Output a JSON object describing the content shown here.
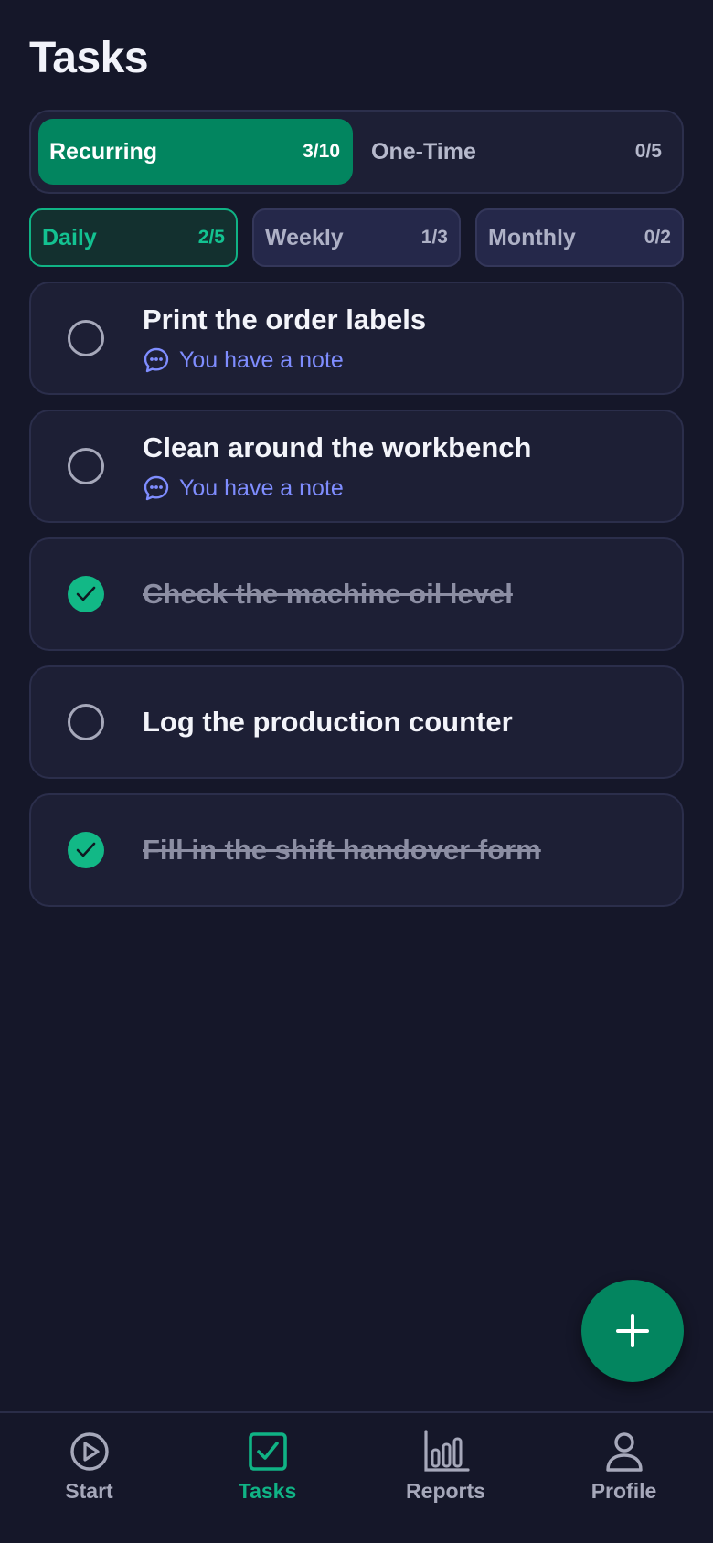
{
  "header": {
    "title": "Tasks"
  },
  "segments": [
    {
      "label": "Recurring",
      "count": "3/10",
      "active": true
    },
    {
      "label": "One-Time",
      "count": "0/5",
      "active": false
    }
  ],
  "frequency": [
    {
      "label": "Daily",
      "count": "2/5",
      "active": true
    },
    {
      "label": "Weekly",
      "count": "1/3",
      "active": false
    },
    {
      "label": "Monthly",
      "count": "0/2",
      "active": false
    }
  ],
  "tasks": [
    {
      "title": "Print the order labels",
      "done": false,
      "note": "You have a note"
    },
    {
      "title": "Clean around the workbench",
      "done": false,
      "note": "You have a note"
    },
    {
      "title": "Check the machine oil level",
      "done": true
    },
    {
      "title": "Log the production counter",
      "done": false
    },
    {
      "title": "Fill in the shift handover form",
      "done": true
    }
  ],
  "nav": [
    {
      "label": "Start",
      "icon": "play-circle-icon",
      "active": false
    },
    {
      "label": "Tasks",
      "icon": "checkbox-icon",
      "active": true
    },
    {
      "label": "Reports",
      "icon": "bar-chart-icon",
      "active": false
    },
    {
      "label": "Profile",
      "icon": "user-icon",
      "active": false
    }
  ],
  "colors": {
    "background": "#151729",
    "card": "#1d1f35",
    "accent": "#02855f",
    "accent_text": "#13c291",
    "note": "#7f8dff",
    "muted": "#a6a8ba"
  }
}
